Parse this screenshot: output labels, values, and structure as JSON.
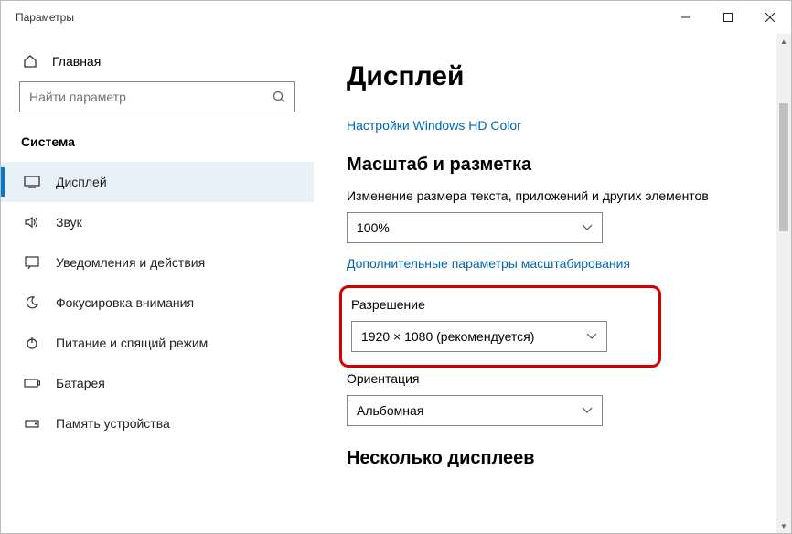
{
  "window": {
    "title": "Параметры"
  },
  "home": {
    "label": "Главная"
  },
  "search": {
    "placeholder": "Найти параметр"
  },
  "section": {
    "label": "Система"
  },
  "nav": {
    "items": [
      {
        "label": "Дисплей"
      },
      {
        "label": "Звук"
      },
      {
        "label": "Уведомления и действия"
      },
      {
        "label": "Фокусировка внимания"
      },
      {
        "label": "Питание и спящий режим"
      },
      {
        "label": "Батарея"
      },
      {
        "label": "Память устройства"
      }
    ]
  },
  "main": {
    "title": "Дисплей",
    "hd_color_link": "Настройки Windows HD Color",
    "scale_heading": "Масштаб и разметка",
    "scale_label": "Изменение размера текста, приложений и других элементов",
    "scale_value": "100%",
    "scale_more_link": "Дополнительные параметры масштабирования",
    "resolution_label": "Разрешение",
    "resolution_value": "1920 × 1080 (рекомендуется)",
    "orientation_label": "Ориентация",
    "orientation_value": "Альбомная",
    "multi_heading": "Несколько дисплеев"
  }
}
